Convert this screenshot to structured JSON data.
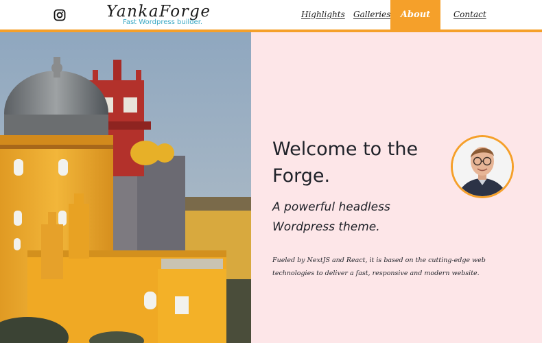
{
  "header": {
    "brand_title": "YankaForge",
    "brand_subtitle": "Fast Wordpress builder.",
    "social_icon": "instagram-icon",
    "nav": [
      {
        "label": "Highlights"
      },
      {
        "label": "Galleries"
      },
      {
        "label": "About",
        "active": true
      },
      {
        "label": "Contact"
      }
    ]
  },
  "hero": {
    "image": "castle-photo",
    "heading": "Welcome to the Forge.",
    "tagline": "A powerful headless Wordpress theme.",
    "description": "Fueled by NextJS and React, it is based on the cutting-edge web technologies to deliver a fast, responsive and modern website.",
    "avatar": "profile-photo"
  },
  "colors": {
    "accent": "#f5a02a",
    "panel_bg": "#fde6e8",
    "subtitle": "#3aa8c4",
    "text": "#1f2229"
  }
}
